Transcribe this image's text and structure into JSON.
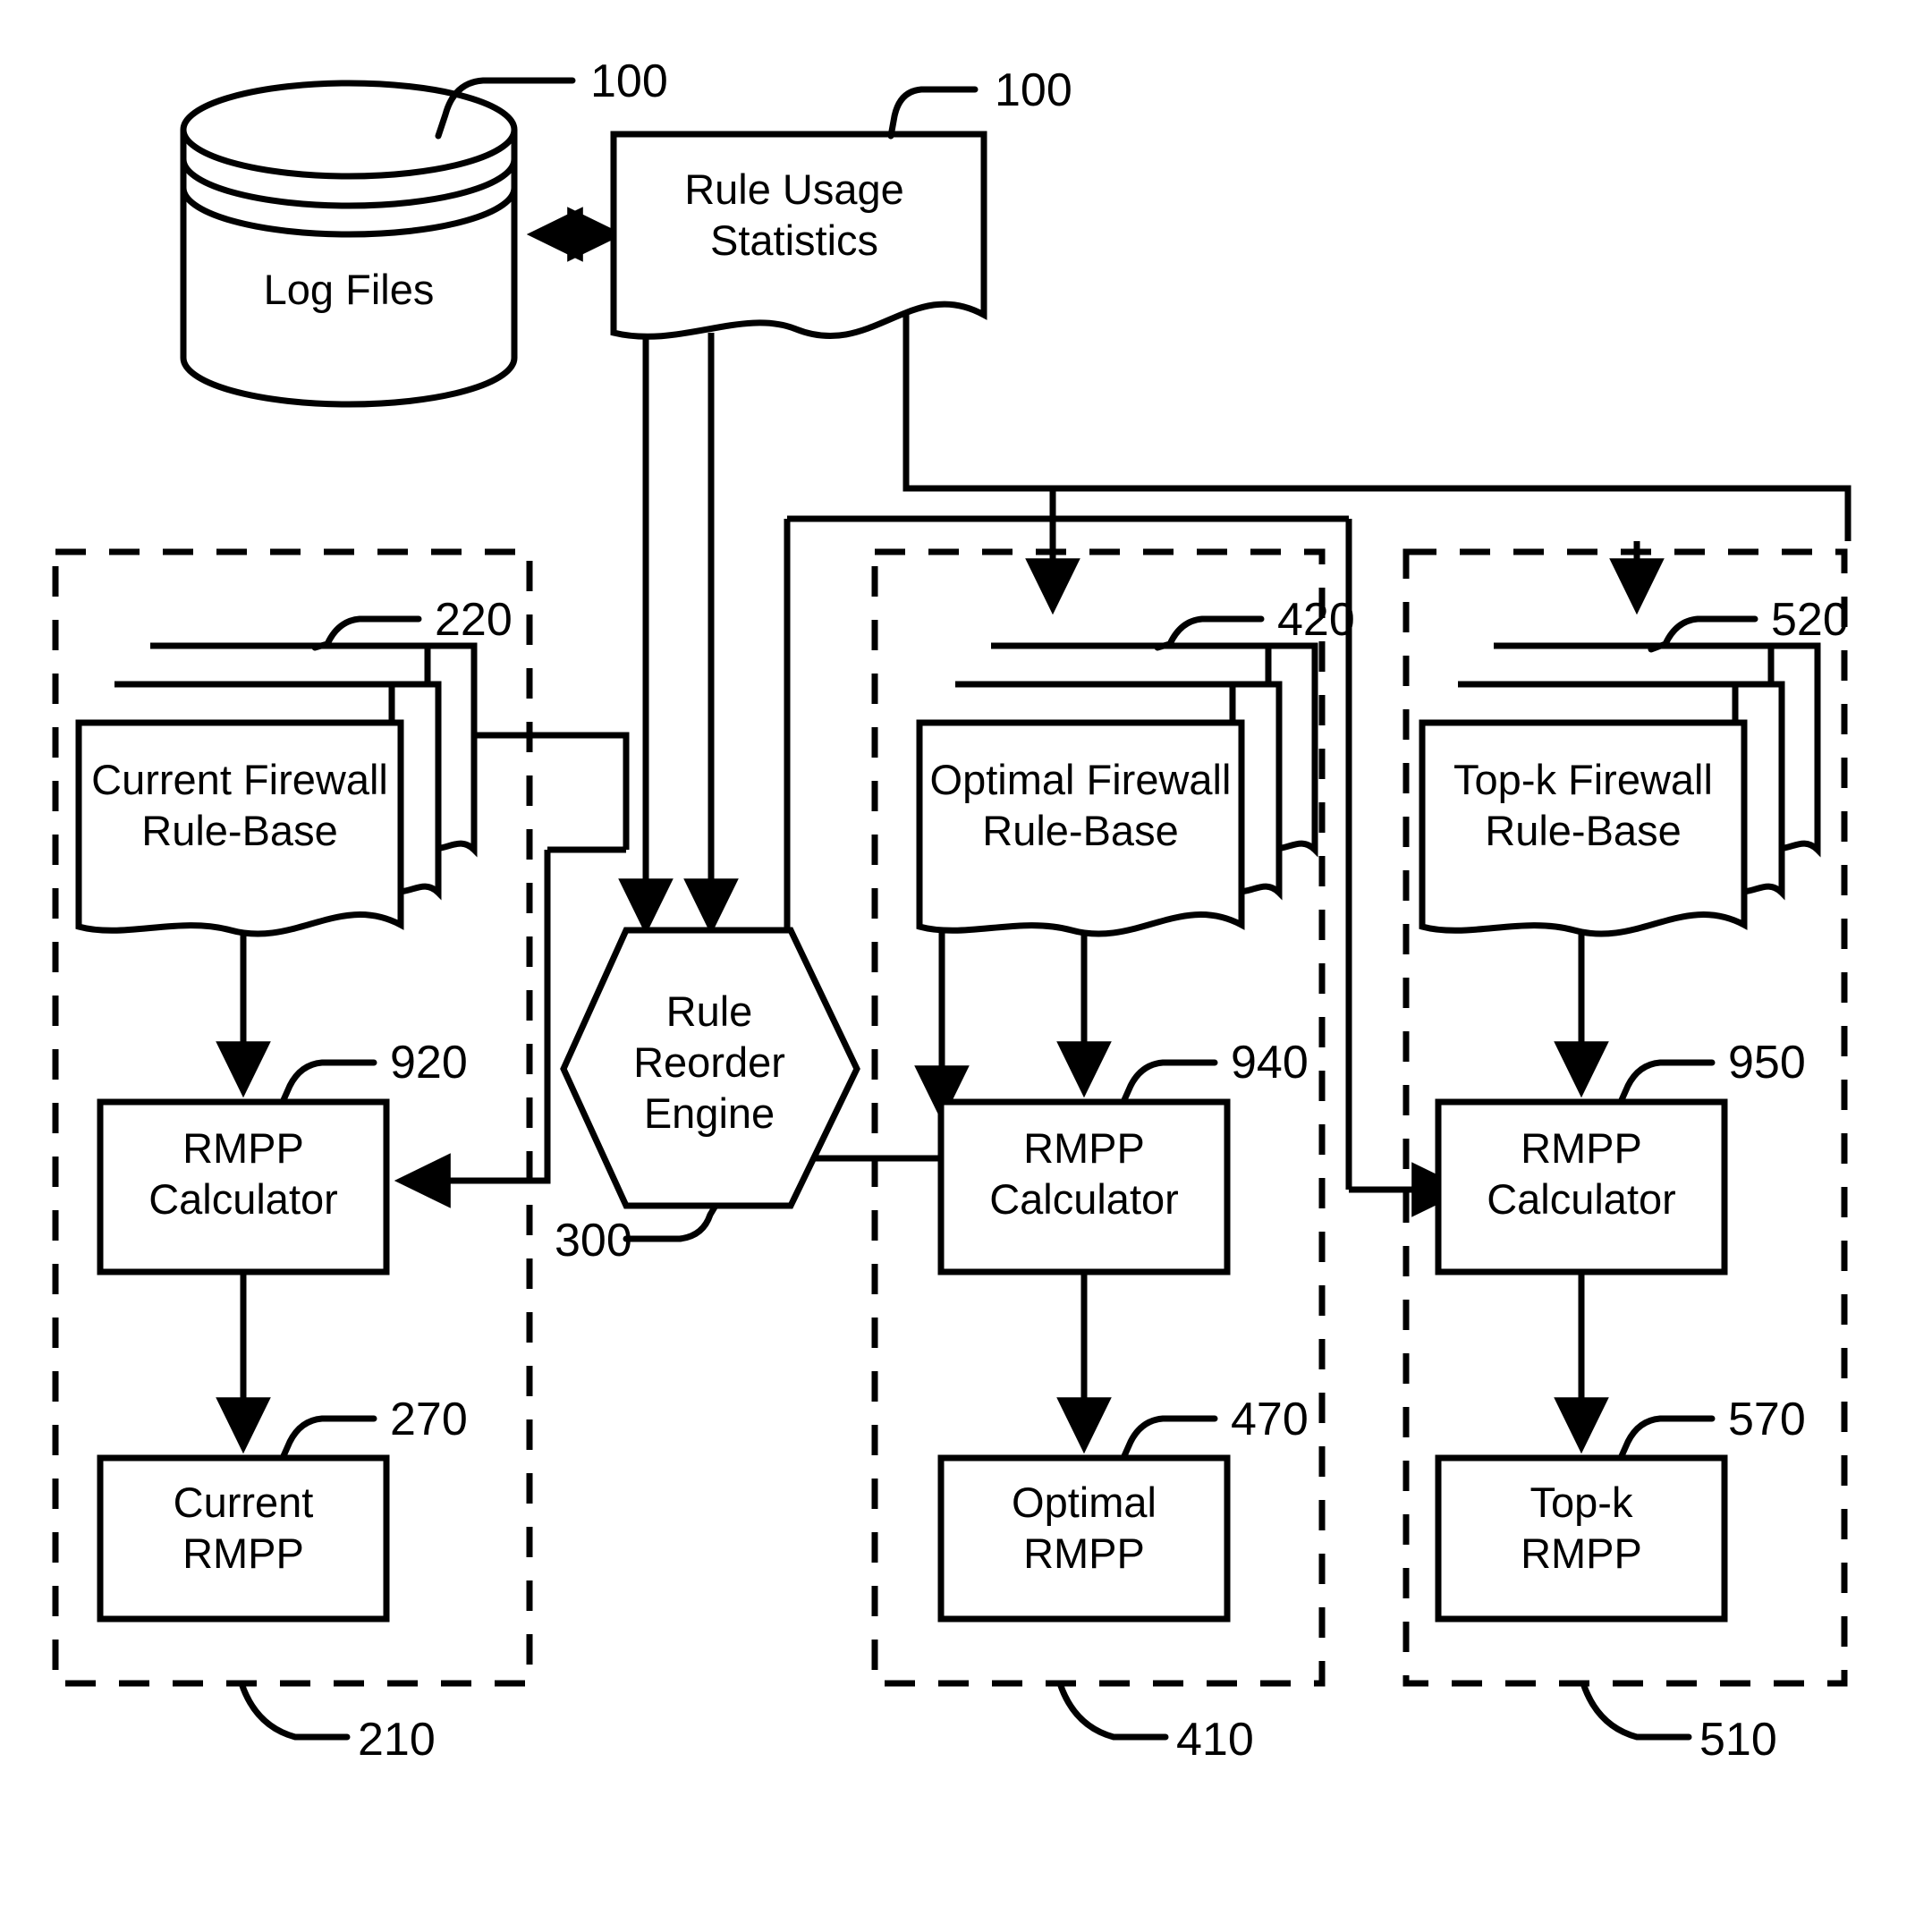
{
  "figure": {
    "title": "Firewall Rule-Base RMPP Comparison Block Diagram",
    "domain": "patent-block-diagram"
  },
  "nodes": {
    "log_files": {
      "label": "Log Files",
      "ref": "100",
      "shape": "cylinder"
    },
    "rule_usage_statistics": {
      "label_line1": "Rule Usage",
      "label_line2": "Statistics",
      "ref": "100",
      "shape": "document"
    },
    "rule_reorder_engine": {
      "label_line1": "Rule",
      "label_line2": "Reorder",
      "label_line3": "Engine",
      "ref": "300",
      "shape": "hexagon"
    },
    "current_rule_base": {
      "label_line1": "Current Firewall",
      "label_line2": "Rule-Base",
      "ref": "220",
      "shape": "multi-document"
    },
    "optimal_rule_base": {
      "label_line1": "Optimal Firewall",
      "label_line2": "Rule-Base",
      "ref": "420",
      "shape": "multi-document"
    },
    "topk_rule_base": {
      "label_line1": "Top-k Firewall",
      "label_line2": "Rule-Base",
      "ref": "520",
      "shape": "multi-document"
    },
    "current_rmpp_calculator": {
      "label_line1": "RMPP",
      "label_line2": "Calculator",
      "ref": "920",
      "shape": "rect"
    },
    "optimal_rmpp_calculator": {
      "label_line1": "RMPP",
      "label_line2": "Calculator",
      "ref": "940",
      "shape": "rect"
    },
    "topk_rmpp_calculator": {
      "label_line1": "RMPP",
      "label_line2": "Calculator",
      "ref": "950",
      "shape": "rect"
    },
    "current_rmpp": {
      "label_line1": "Current",
      "label_line2": "RMPP",
      "ref": "270",
      "shape": "rect"
    },
    "optimal_rmpp": {
      "label_line1": "Optimal",
      "label_line2": "RMPP",
      "ref": "470",
      "shape": "rect"
    },
    "topk_rmpp": {
      "label_line1": "Top-k",
      "label_line2": "RMPP",
      "ref": "570",
      "shape": "rect"
    }
  },
  "groups": {
    "current_group": {
      "ref": "210",
      "style": "dashed"
    },
    "optimal_group": {
      "ref": "410",
      "style": "dashed"
    },
    "topk_group": {
      "ref": "510",
      "style": "dashed"
    }
  },
  "colors": {
    "stroke": "#000000",
    "background": "#ffffff"
  }
}
